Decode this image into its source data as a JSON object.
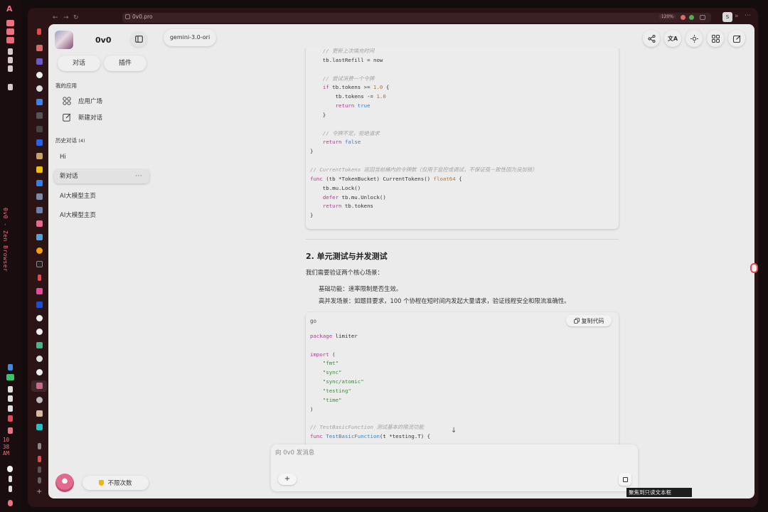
{
  "desktop": {
    "vertical_title": "0v0 - Zen Browser",
    "clock_lines": [
      "10",
      "38",
      "AM"
    ],
    "accent": "#f07080"
  },
  "browser": {
    "url": "0v0.pro",
    "zoom": "120%"
  },
  "sidebar": {
    "app_name": "0v0",
    "chat_button": "对话",
    "plugin_button": "插件",
    "my_apps_title": "我的应用",
    "my_apps": [
      {
        "label": "应用广场",
        "icon": "app-grid-icon"
      },
      {
        "label": "新建对话",
        "icon": "edit-icon"
      }
    ],
    "history_title": "历史对话",
    "history_count": "(4)",
    "history": [
      {
        "label": "Hi",
        "active": false
      },
      {
        "label": "新对话",
        "active": true
      },
      {
        "label": "AI大模型主页",
        "active": false
      },
      {
        "label": "AI大模型主页",
        "active": false
      }
    ],
    "quota_label": "不限次数"
  },
  "header": {
    "model": "gemini-3.0-ori"
  },
  "content": {
    "code1_lines": [
      "    // 更新上次填充时间",
      "    tb.lastRefill = now",
      "",
      "    // 尝试消费一个令牌",
      "    if tb.tokens >= 1.0 {",
      "        tb.tokens -= 1.0",
      "        return true",
      "    }",
      "",
      "    // 令牌不足，拒绝请求",
      "    return false",
      "}",
      "",
      "// CurrentTokens 返回当前桶内的令牌数（仅用于监控或调试，不保证强一致性因为没加锁）",
      "func (tb *TokenBucket) CurrentTokens() float64 {",
      "    tb.mu.Lock()",
      "    defer tb.mu.Unlock()",
      "    return tb.tokens",
      "}"
    ],
    "section_title": "2. 单元测试与并发测试",
    "intro": "我们需要验证两个核心场景：",
    "bullets": [
      "基础功能：速率限制是否生效。",
      "高并发场景：如题目要求，100 个协程在短时间内发起大量请求，验证线程安全和限流准确性。"
    ],
    "code2_lang": "go",
    "copy_label": "复制代码",
    "code2_lines": [
      "",
      "package limiter",
      "",
      "import (",
      "    \"fmt\"",
      "    \"sync\"",
      "    \"sync/atomic\"",
      "    \"testing\"",
      "    \"time\"",
      ")",
      "",
      "// TestBasicFunction 测试基本的限流功能",
      "func TestBasicFunction(t *testing.T) {"
    ]
  },
  "composer": {
    "placeholder": "向 0v0 发消息",
    "tooltip": "聚焦到只读文本框"
  }
}
